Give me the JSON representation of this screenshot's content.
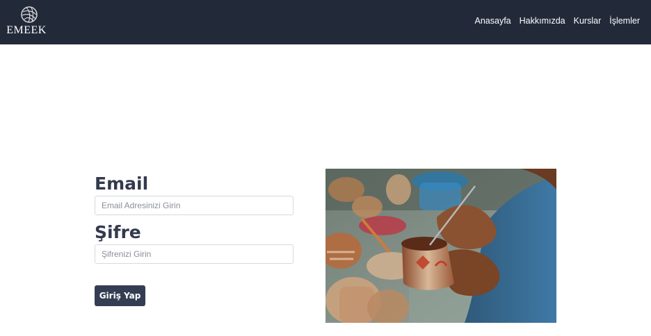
{
  "brand": {
    "name": "EMEEK",
    "icon": "yarn-ball-logo-icon"
  },
  "nav": {
    "items": [
      {
        "label": "Anasayfa"
      },
      {
        "label": "Hakkımızda"
      },
      {
        "label": "Kurslar"
      },
      {
        "label": "İşlemler"
      }
    ]
  },
  "form": {
    "email_label": "Email",
    "email_placeholder": "Email Adresinizi Girin",
    "email_value": "",
    "password_label": "Şifre",
    "password_placeholder": "Şifrenizi Girin",
    "password_value": "",
    "submit_label": "Giriş Yap"
  },
  "image": {
    "subject": "pottery-painting-photo"
  },
  "colors": {
    "navbar_bg": "#222a3a",
    "heading": "#343a4d",
    "button_bg": "#343d52",
    "page_bg": "#ffffff"
  }
}
